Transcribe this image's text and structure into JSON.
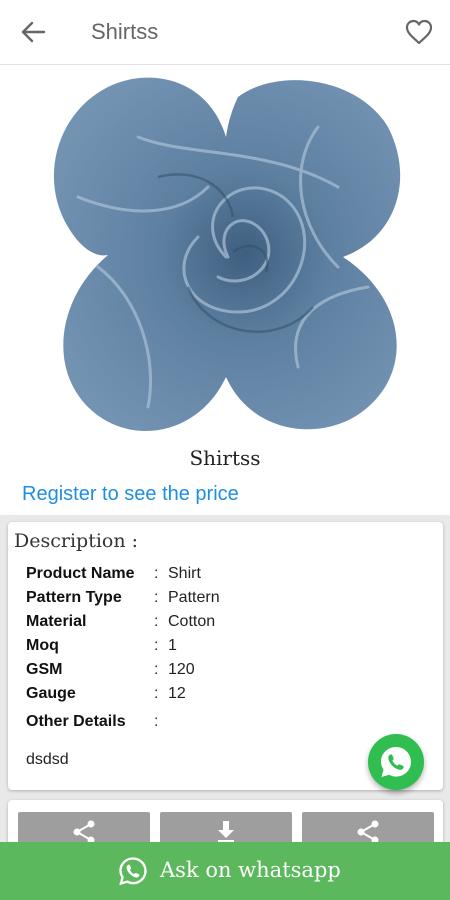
{
  "appbar": {
    "title": "Shirtss",
    "back_icon": "arrow-left-icon",
    "favorite_icon": "heart-outline-icon"
  },
  "product": {
    "name": "Shirtss",
    "image": "blue-fabric-swirl-image",
    "price_link": "Register to see the price"
  },
  "description": {
    "heading": "Description :",
    "specs": [
      {
        "label": "Product Name",
        "value": "Shirt"
      },
      {
        "label": "Pattern Type",
        "value": "Pattern"
      },
      {
        "label": "Material",
        "value": "Cotton"
      },
      {
        "label": "Moq",
        "value": "1"
      },
      {
        "label": "GSM",
        "value": "120"
      },
      {
        "label": "Gauge",
        "value": "12"
      }
    ],
    "colon": ":",
    "other_details_label": "Other Details",
    "other_details_value": "dsdsd"
  },
  "actions": [
    {
      "icon": "share-icon"
    },
    {
      "icon": "download-icon"
    },
    {
      "icon": "share-icon"
    }
  ],
  "whatsapp": {
    "fab_icon": "whatsapp-icon",
    "bar_label": "Ask on whatsapp"
  },
  "colors": {
    "link": "#1e8fe0",
    "whatsapp_green": "#5cb85c",
    "fabric_blue": "#5e80a0",
    "action_gray": "#9e9e9e"
  }
}
